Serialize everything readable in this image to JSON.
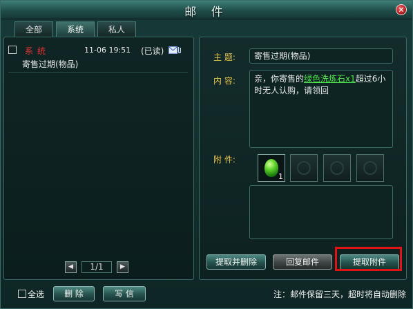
{
  "window": {
    "title": "邮 件",
    "close_icon": "close-icon"
  },
  "tabs": [
    {
      "label": "全部",
      "active": false
    },
    {
      "label": "系统",
      "active": true
    },
    {
      "label": "私人",
      "active": false
    }
  ],
  "mail_list": {
    "items": [
      {
        "sender": "系统",
        "date": "11-06 19:51",
        "status": "(已读)",
        "subject": "寄售过期(物品)",
        "icons": [
          "envelope-icon",
          "paperclip-icon"
        ]
      }
    ],
    "pager": {
      "prev_icon": "arrow-left-icon",
      "label": "1/1",
      "next_icon": "arrow-right-icon"
    }
  },
  "detail": {
    "subject_label": "主  题:",
    "subject_value": "寄售过期(物品)",
    "content_label": "内  容:",
    "content_prefix": "亲，你寄售的",
    "content_item": "绿色洗炼石x1",
    "content_suffix": "超过6小时无人认购，请领回",
    "attachment_label": "附  件:",
    "attachment_count": "1",
    "buttons": {
      "take_delete": "提取并删除",
      "reply": "回复邮件",
      "take_attachment": "提取附件"
    }
  },
  "footer": {
    "select_all": "全选",
    "delete": "删 除",
    "write": "写 信",
    "note": "注：邮件保留三天，超时将自动删除"
  },
  "colors": {
    "accent_gold": "#e6c24a",
    "sender_red": "#e03232",
    "item_green": "#4ee84a",
    "highlight_red": "#e01414"
  }
}
